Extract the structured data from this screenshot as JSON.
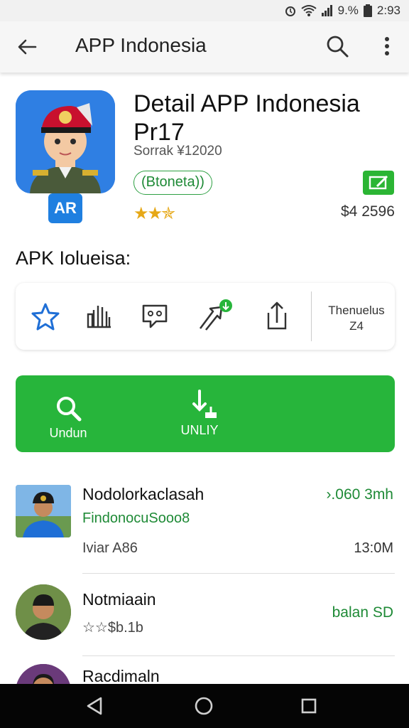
{
  "status_bar": {
    "signal_text": "9.%",
    "time": "2:93"
  },
  "app_bar": {
    "title": "APP Indonesia"
  },
  "app": {
    "badge": "AR",
    "title": "Detail APP Indonesia Pr17",
    "subtitle": "Sorrak ¥12020",
    "tag": "(Btoneta))",
    "rating": "★★✯",
    "price": "$4 2596"
  },
  "section": {
    "title": "APK Iolueisa:"
  },
  "actions": {
    "items": [
      {
        "icon": "star-icon"
      },
      {
        "icon": "hand-icon"
      },
      {
        "icon": "chat-icon"
      },
      {
        "icon": "share-arrow-icon"
      },
      {
        "icon": "upload-icon"
      }
    ],
    "side_text_1": "Thenuelus",
    "side_text_2": "Z4"
  },
  "primary_actions": {
    "left_label": "Undun",
    "right_label": "UNLIY"
  },
  "list": [
    {
      "name": "Nodolorkaclasah",
      "sub": "FindonocuSooo8",
      "meta": "Iviar A86",
      "right_top": "›.060 3mh",
      "right_bottom": "13:0M"
    },
    {
      "name": "Notmiaain",
      "sub": "",
      "meta": "☆☆$b.1b",
      "right_top": "balan SD",
      "right_bottom": ""
    },
    {
      "name": "Racdimaln",
      "sub": "",
      "meta": "",
      "right_top": "",
      "right_bottom": ""
    }
  ],
  "colors": {
    "accent_green": "#27b53b",
    "rating_gold": "#e6a817",
    "link_blue": "#1f7fe0"
  }
}
